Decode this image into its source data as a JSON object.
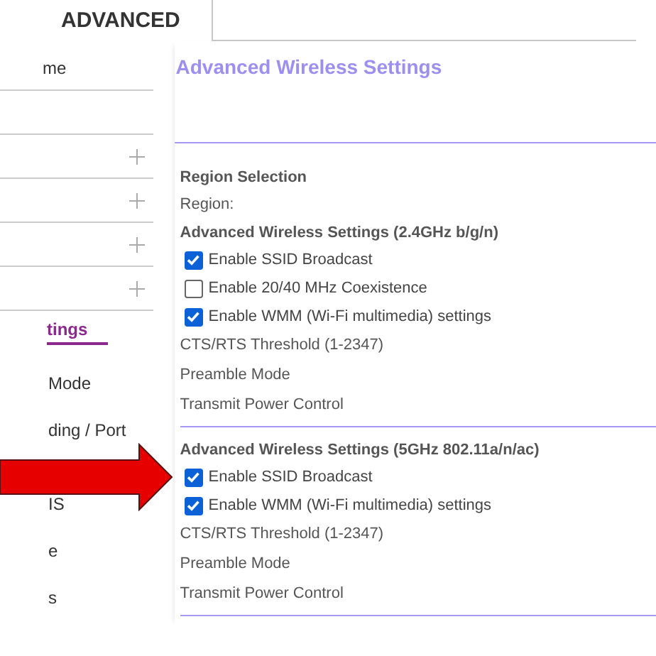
{
  "tab": {
    "label": "ADVANCED",
    "selected": true
  },
  "sidebar": {
    "items": [
      {
        "kind": "link",
        "label": "me",
        "selected": false
      },
      {
        "kind": "blank"
      },
      {
        "kind": "expandable",
        "expanded": false
      },
      {
        "kind": "expandable",
        "expanded": false
      },
      {
        "kind": "expandable",
        "expanded": false
      },
      {
        "kind": "expandable",
        "expanded": false
      },
      {
        "kind": "link",
        "label": "tings",
        "selected": true
      },
      {
        "kind": "link",
        "label": "Mode",
        "selected": false
      },
      {
        "kind": "link",
        "label": "ding / Port",
        "selected": false
      },
      {
        "kind": "link",
        "label": "IS",
        "selected": false
      },
      {
        "kind": "link",
        "label": "e",
        "selected": false
      },
      {
        "kind": "link",
        "label": "s",
        "selected": false
      }
    ]
  },
  "main": {
    "title": "Advanced Wireless Settings",
    "sections": [
      {
        "rows": [
          {
            "kind": "heading",
            "label": "Region Selection"
          },
          {
            "kind": "label",
            "label": "Region:"
          },
          {
            "kind": "heading",
            "label": "Advanced Wireless Settings (2.4GHz b/g/n)"
          },
          {
            "kind": "checkbox",
            "label": "Enable SSID Broadcast",
            "checked": true
          },
          {
            "kind": "checkbox",
            "label": "Enable 20/40 MHz Coexistence",
            "checked": false
          },
          {
            "kind": "checkbox",
            "label": "Enable WMM (Wi-Fi multimedia) settings",
            "checked": true
          },
          {
            "kind": "label",
            "label": "CTS/RTS Threshold (1-2347)"
          },
          {
            "kind": "label",
            "label": "Preamble Mode"
          },
          {
            "kind": "label",
            "label": "Transmit Power Control"
          }
        ]
      },
      {
        "rows": [
          {
            "kind": "heading",
            "label": "Advanced Wireless Settings (5GHz 802.11a/n/ac)"
          },
          {
            "kind": "checkbox",
            "label": "Enable SSID Broadcast",
            "checked": true
          },
          {
            "kind": "checkbox",
            "label": "Enable WMM (Wi-Fi multimedia) settings",
            "checked": true
          },
          {
            "kind": "label",
            "label": "CTS/RTS Threshold (1-2347)"
          },
          {
            "kind": "label",
            "label": "Preamble Mode"
          },
          {
            "kind": "label",
            "label": "Transmit Power Control"
          }
        ]
      }
    ]
  }
}
